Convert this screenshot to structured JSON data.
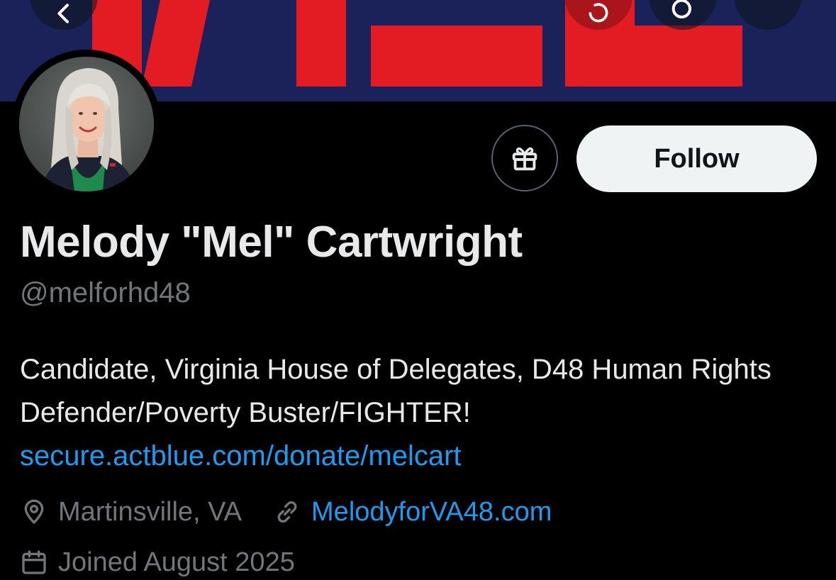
{
  "colors": {
    "banner_bg": "#1a2259",
    "banner_red": "#e31b23",
    "text_primary": "#e7e9ea",
    "text_secondary": "#71767b",
    "link": "#1d9bf0",
    "follow_bg": "#eff3f4"
  },
  "header": {
    "back_icon": "arrow-left-icon",
    "actions": [
      "refresh-icon",
      "search-icon",
      "more-icon"
    ]
  },
  "actions": {
    "gift_icon": "gift-icon",
    "follow_label": "Follow"
  },
  "profile": {
    "display_name": "Melody \"Mel\" Cartwright",
    "handle": "@melforhd48",
    "bio_text": "Candidate, Virginia House of Delegates, D48 Human Rights Defender/Poverty Buster/FIGHTER!",
    "bio_link": "secure.actblue.com/donate/melcart",
    "location": "Martinsville, VA",
    "website": "MelodyforVA48.com",
    "joined": "Joined August 2025"
  }
}
